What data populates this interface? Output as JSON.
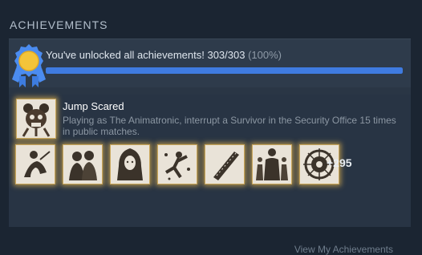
{
  "section": {
    "title": "ACHIEVEMENTS"
  },
  "summary": {
    "message": "You've unlocked all achievements! 303/303",
    "percent_text": "(100%)",
    "progress_fraction": 1.0
  },
  "featured": {
    "icon": "animatronic-achievement-icon",
    "name": "Jump Scared",
    "description": "Playing as The Animatronic, interrupt a Survivor in the Security Office 15 times in public matches."
  },
  "achievements": [
    {
      "icon": "survivor-crouch-achievement-icon"
    },
    {
      "icon": "survivor-pair-achievement-icon"
    },
    {
      "icon": "hooded-woman-achievement-icon"
    },
    {
      "icon": "survivor-splash-achievement-icon"
    },
    {
      "icon": "machete-achievement-icon"
    },
    {
      "icon": "survivor-group-achievement-icon"
    },
    {
      "icon": "entity-sigil-achievement-icon"
    }
  ],
  "more": {
    "label": "+295"
  },
  "footer": {
    "link_label": "View My Achievements"
  },
  "colors": {
    "accent_blue": "#3f7be0",
    "badge_gold": "#f3c43a",
    "tile_glow": "#d6ac50"
  }
}
